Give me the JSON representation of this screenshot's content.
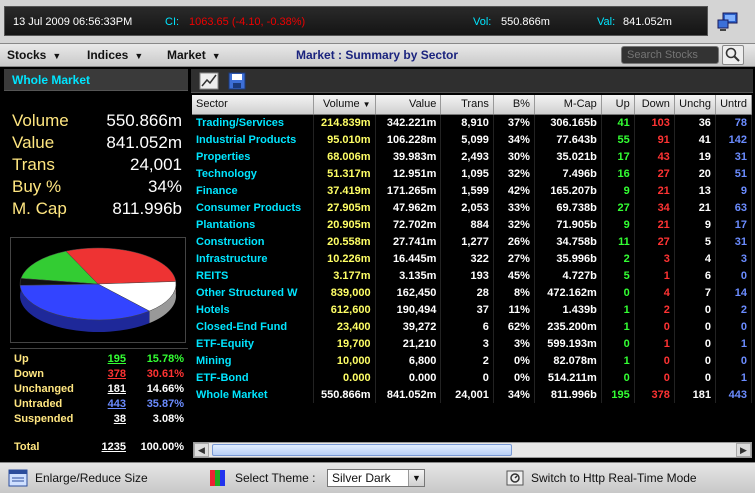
{
  "status": {
    "datetime": "13 Jul 2009 06:56:33PM",
    "ci_label": "CI:",
    "ci_value": "1063.65 (-4.10, -0.38%)",
    "vol_label": "Vol:",
    "vol_value": "550.866m",
    "val_label": "Val:",
    "val_value": "841.052m"
  },
  "menu": {
    "stocks": "Stocks",
    "indices": "Indices",
    "market": "Market",
    "title": "Market : Summary by Sector",
    "search_placeholder": "Search Stocks"
  },
  "left": {
    "heading": "Whole Market",
    "stats": [
      {
        "label": "Volume",
        "value": "550.866m"
      },
      {
        "label": "Value",
        "value": "841.052m"
      },
      {
        "label": "Trans",
        "value": "24,001"
      },
      {
        "label": "Buy %",
        "value": "34%"
      },
      {
        "label": "M. Cap",
        "value": "811.996b"
      }
    ],
    "pie": [
      {
        "name": "Up",
        "pct": 15.78,
        "color": "#33cc33"
      },
      {
        "name": "Down",
        "pct": 30.61,
        "color": "#ee3333"
      },
      {
        "name": "Unchanged",
        "pct": 14.66,
        "color": "#ffffff"
      },
      {
        "name": "Untraded",
        "pct": 35.87,
        "color": "#3344ff"
      },
      {
        "name": "Suspended",
        "pct": 3.08,
        "color": "#111111"
      }
    ],
    "advance": [
      {
        "label": "Up",
        "count": "195",
        "pct": "15.78%",
        "color": "#33ff33"
      },
      {
        "label": "Down",
        "count": "378",
        "pct": "30.61%",
        "color": "#ff3333"
      },
      {
        "label": "Unchanged",
        "count": "181",
        "pct": "14.66%",
        "color": "#ffffff"
      },
      {
        "label": "Untraded",
        "count": "443",
        "pct": "35.87%",
        "color": "#6b8cff"
      },
      {
        "label": "Suspended",
        "count": "38",
        "pct": "3.08%",
        "color": "#ffffff"
      },
      {
        "label": "Total",
        "count": "1235",
        "pct": "100.00%",
        "color": "#ffffff"
      }
    ]
  },
  "table": {
    "headers": [
      "Sector",
      "Volume",
      "Value",
      "Trans",
      "B%",
      "M-Cap",
      "Up",
      "Down",
      "Unchg",
      "Untrd"
    ],
    "rows": [
      [
        "Trading/Services",
        "214.839m",
        "342.221m",
        "8,910",
        "37%",
        "306.165b",
        "41",
        "103",
        "36",
        "78"
      ],
      [
        "Industrial Products",
        "95.010m",
        "106.228m",
        "5,099",
        "34%",
        "77.643b",
        "55",
        "91",
        "41",
        "142"
      ],
      [
        "Properties",
        "68.006m",
        "39.983m",
        "2,493",
        "30%",
        "35.021b",
        "17",
        "43",
        "19",
        "31"
      ],
      [
        "Technology",
        "51.317m",
        "12.951m",
        "1,095",
        "32%",
        "7.496b",
        "16",
        "27",
        "20",
        "51"
      ],
      [
        "Finance",
        "37.419m",
        "171.265m",
        "1,599",
        "42%",
        "165.207b",
        "9",
        "21",
        "13",
        "9"
      ],
      [
        "Consumer Products",
        "27.905m",
        "47.962m",
        "2,053",
        "33%",
        "69.738b",
        "27",
        "34",
        "21",
        "63"
      ],
      [
        "Plantations",
        "20.905m",
        "72.702m",
        "884",
        "32%",
        "71.905b",
        "9",
        "21",
        "9",
        "17"
      ],
      [
        "Construction",
        "20.558m",
        "27.741m",
        "1,277",
        "26%",
        "34.758b",
        "11",
        "27",
        "5",
        "31"
      ],
      [
        "Infrastructure",
        "10.226m",
        "16.445m",
        "322",
        "27%",
        "35.996b",
        "2",
        "3",
        "4",
        "3"
      ],
      [
        "REITS",
        "3.177m",
        "3.135m",
        "193",
        "45%",
        "4.727b",
        "5",
        "1",
        "6",
        "0"
      ],
      [
        "Other Structured W",
        "839,000",
        "162,450",
        "28",
        "8%",
        "472.162m",
        "0",
        "4",
        "7",
        "14"
      ],
      [
        "Hotels",
        "612,600",
        "190,494",
        "37",
        "11%",
        "1.439b",
        "1",
        "2",
        "0",
        "2"
      ],
      [
        "Closed-End Fund",
        "23,400",
        "39,272",
        "6",
        "62%",
        "235.200m",
        "1",
        "0",
        "0",
        "0"
      ],
      [
        "ETF-Equity",
        "19,700",
        "21,210",
        "3",
        "3%",
        "599.193m",
        "0",
        "1",
        "0",
        "1"
      ],
      [
        "Mining",
        "10,000",
        "6,800",
        "2",
        "0%",
        "82.078m",
        "1",
        "0",
        "0",
        "0"
      ],
      [
        "ETF-Bond",
        "0.000",
        "0.000",
        "0",
        "0%",
        "514.211m",
        "0",
        "0",
        "0",
        "1"
      ],
      [
        "Whole Market",
        "550.866m",
        "841.052m",
        "24,001",
        "34%",
        "811.996b",
        "195",
        "378",
        "181",
        "443"
      ]
    ]
  },
  "bottom": {
    "enlarge": "Enlarge/Reduce Size",
    "theme_label": "Select Theme :",
    "theme_value": "Silver Dark",
    "switch": "Switch to Http Real-Time Mode"
  }
}
